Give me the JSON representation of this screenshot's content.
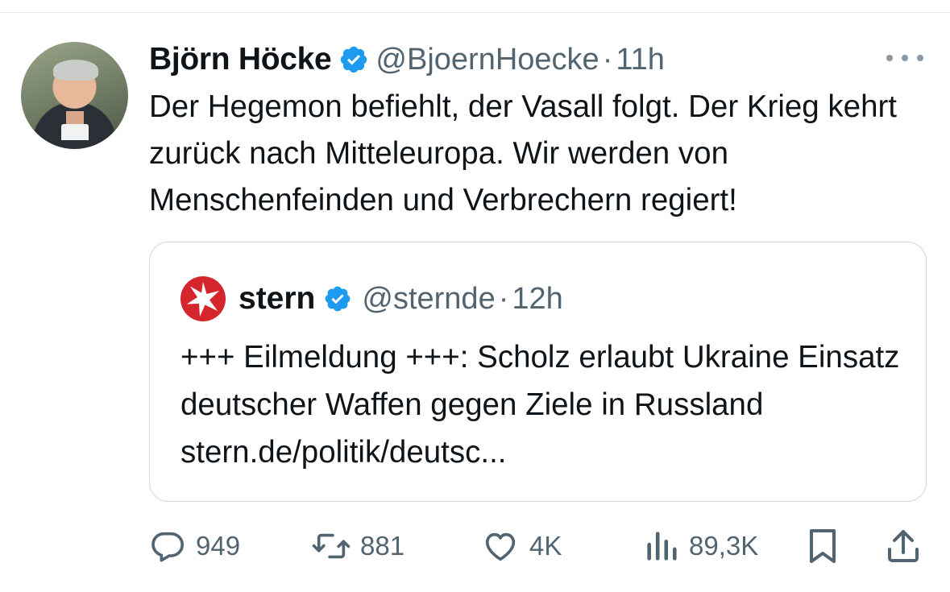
{
  "tweet": {
    "author_name": "Björn Höcke",
    "handle": "@BjoernHoecke",
    "separator": "·",
    "time": "11h",
    "text": "Der Hegemon befiehlt, der Vasall folgt. Der Krieg kehrt zurück nach Mitteleuropa. Wir werden von Menschenfeinden und Verbrechern regiert!",
    "verified": true
  },
  "quote": {
    "author_name": "stern",
    "handle": "@sternde",
    "separator": "·",
    "time": "12h",
    "text": "+++ Eilmeldung +++: Scholz erlaubt Ukraine Einsatz deutscher Waffen gegen Ziele in Russland stern.de/politik/deutsc...",
    "verified": true
  },
  "actions": {
    "replies": "949",
    "reposts": "881",
    "likes": "4K",
    "views": "89,3K"
  },
  "icons": {
    "verified": "verified-badge-icon",
    "more": "more-horizontal-icon",
    "reply": "reply-icon",
    "repost": "repost-icon",
    "like": "heart-icon",
    "views": "views-chart-icon",
    "bookmark": "bookmark-icon",
    "share": "share-icon",
    "stern_logo": "stern-star-logo"
  },
  "colors": {
    "verified_blue": "#1d9bf0",
    "secondary_text": "#536471",
    "stern_red": "#d4262c"
  }
}
